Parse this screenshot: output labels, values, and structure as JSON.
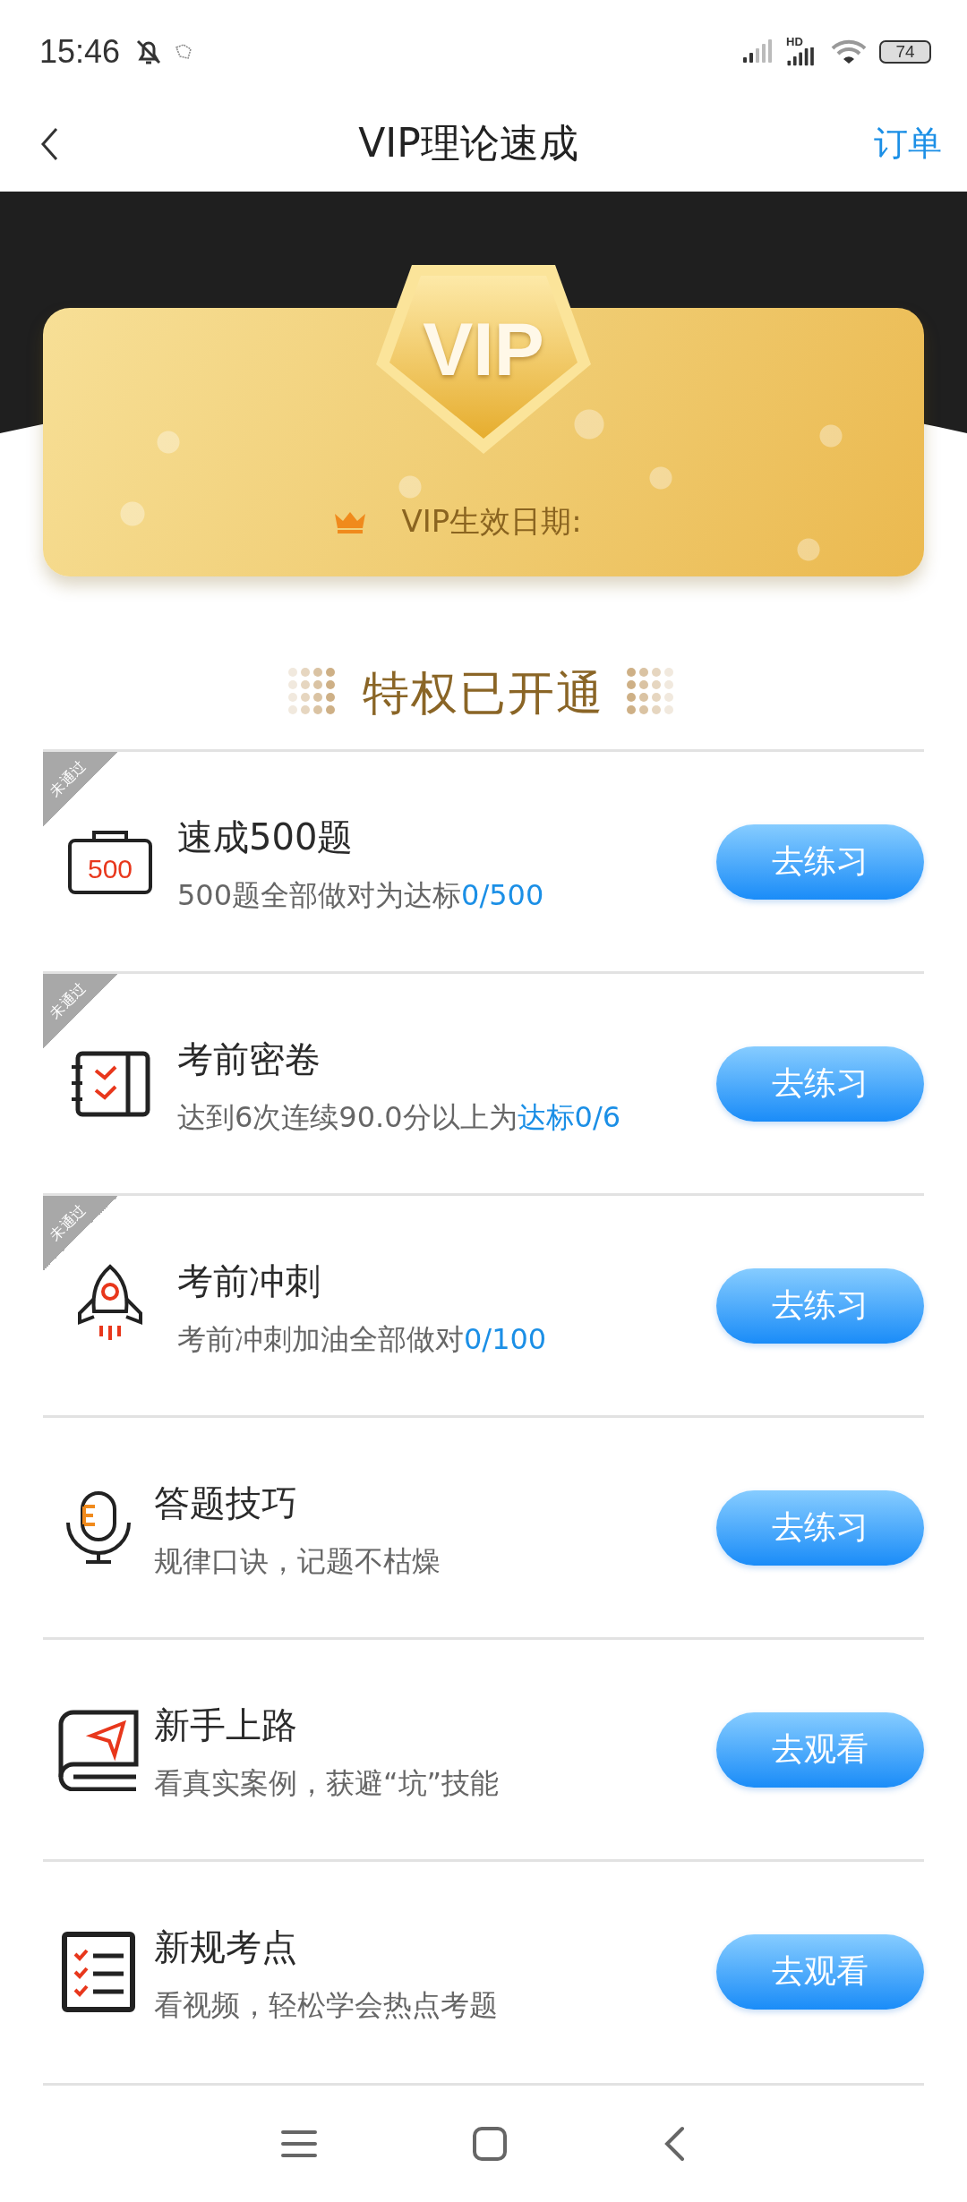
{
  "status_bar": {
    "time": "15:46",
    "network_label": "HD",
    "battery": "74"
  },
  "nav": {
    "title": "VIP理论速成",
    "action": "订单"
  },
  "vip_card": {
    "badge": "VIP",
    "validity_label": "VIP生效日期:"
  },
  "section": {
    "title": "特权已开通"
  },
  "items": [
    {
      "kind": "case",
      "icon_label": "500",
      "ribbon": "未通过",
      "title": "速成500题",
      "subtitle": "500题全部做对为达标",
      "progress": "0/500",
      "button": "去练习"
    },
    {
      "kind": "notebook",
      "ribbon": "未通过",
      "title": "考前密卷",
      "subtitle": "达到6次连续90.0分以上为",
      "progress": "达标0/6",
      "button": "去练习"
    },
    {
      "kind": "rocket",
      "ribbon": "未通过",
      "title": "考前冲刺",
      "subtitle": "考前冲刺加油全部做对",
      "progress": "0/100",
      "button": "去练习"
    },
    {
      "kind": "mic",
      "title": "答题技巧",
      "subtitle": "规律口诀，记题不枯燥",
      "button": "去练习"
    },
    {
      "kind": "book",
      "title": "新手上路",
      "subtitle": "看真实案例，获避“坑”技能",
      "button": "去观看"
    },
    {
      "kind": "checklist",
      "title": "新规考点",
      "subtitle": "看视频，轻松学会热点考题",
      "button": "去观看"
    }
  ]
}
